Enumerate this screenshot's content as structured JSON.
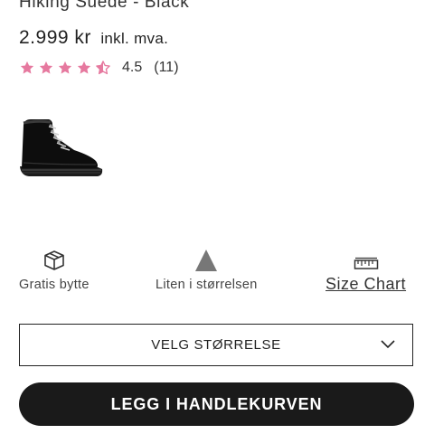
{
  "product": {
    "title": "Hiking Suede - Black",
    "price": "2.999 kr",
    "vat_note": "inkl. mva.",
    "rating_value": "4.5",
    "rating_count": "(11)",
    "rating_stars": 4.5,
    "star_color": "#e6799f"
  },
  "features": {
    "exchange": {
      "icon": "box-icon",
      "label": "Gratis bytte"
    },
    "fit": {
      "icon": "triangle-icon",
      "label": "Liten i størrelsen"
    },
    "size_chart": {
      "icon": "ruler-icon",
      "label": "Size Chart"
    }
  },
  "size_select": {
    "label": "VELG STØRRELSE"
  },
  "cart_button": {
    "label": "LEGG I HANDLEKURVEN"
  }
}
